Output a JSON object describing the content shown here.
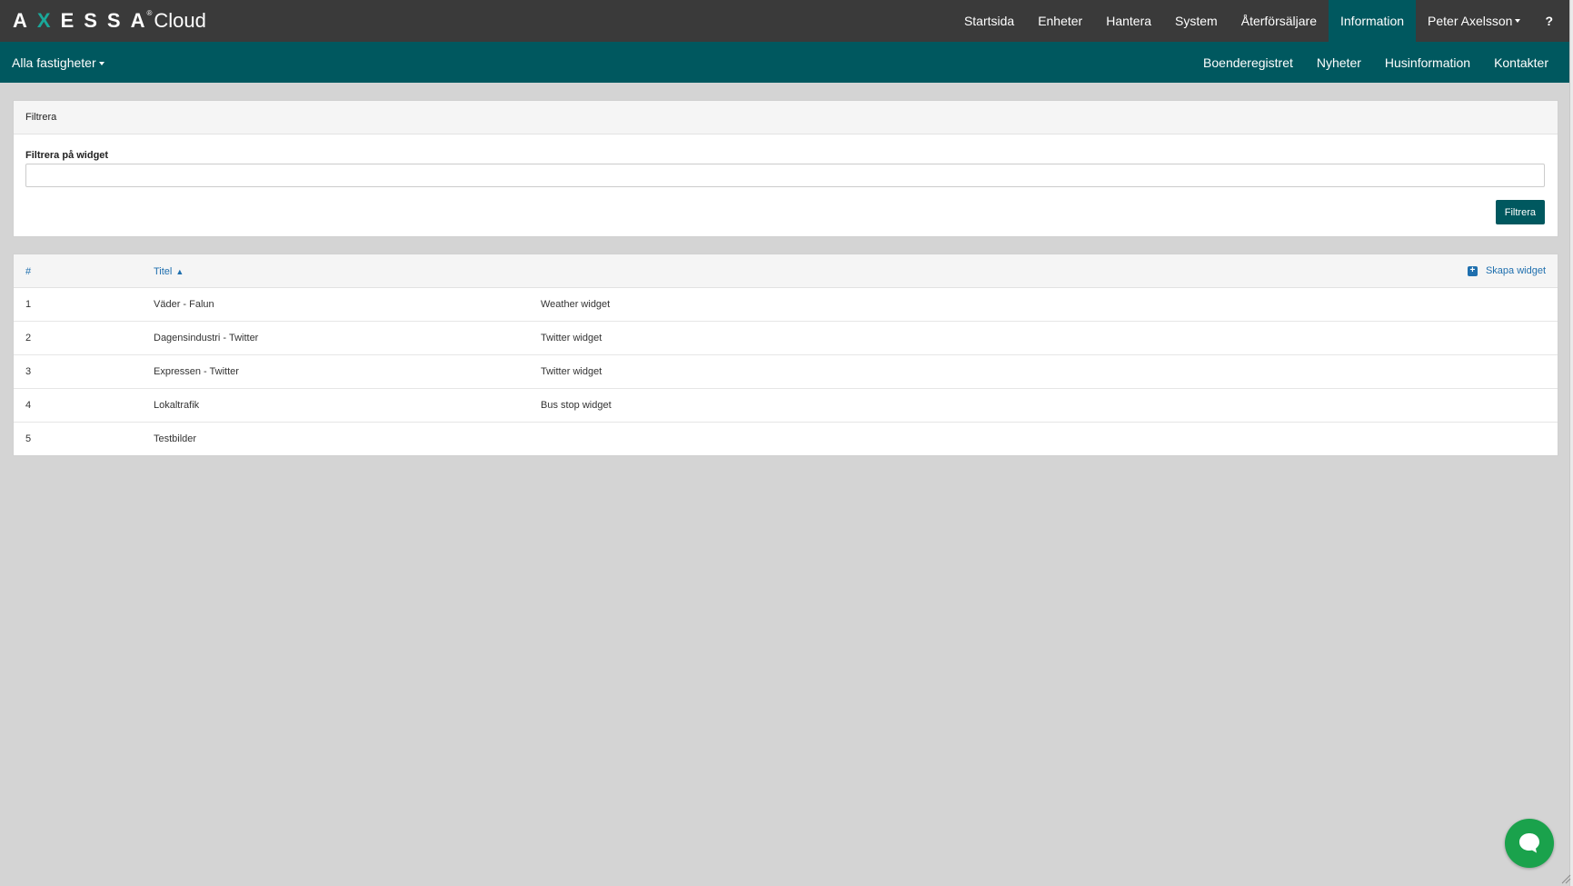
{
  "brand": {
    "letters_1": "A",
    "letters_x": "X",
    "letters_2": "ESSA",
    "reg": "®",
    "cloud": "Cloud"
  },
  "topnav": {
    "items": [
      "Startsida",
      "Enheter",
      "Hantera",
      "System",
      "Återförsäljare",
      "Information",
      "Peter Axelsson",
      "?"
    ],
    "active": "Information"
  },
  "subbar": {
    "property_select": "Alla fastigheter",
    "items": [
      "Boenderegistret",
      "Nyheter",
      "Husinformation",
      "Kontakter"
    ]
  },
  "filter": {
    "heading": "Filtrera",
    "label": "Filtrera på widget",
    "value": "",
    "button": "Filtrera"
  },
  "table": {
    "columns": [
      "#",
      "Titel"
    ],
    "create_label": "Skapa widget",
    "rows": [
      {
        "id": "1",
        "title": "Väder - Falun",
        "type": "Weather widget"
      },
      {
        "id": "2",
        "title": "Dagensindustri - Twitter",
        "type": "Twitter widget"
      },
      {
        "id": "3",
        "title": "Expressen - Twitter",
        "type": "Twitter widget"
      },
      {
        "id": "4",
        "title": "Lokaltrafik",
        "type": "Bus stop widget"
      },
      {
        "id": "5",
        "title": "Testbilder",
        "type": ""
      }
    ]
  },
  "icons": {
    "sort": "sort-icon",
    "plus": "plus-square-icon",
    "chat": "chat-bubble-icon"
  },
  "colors": {
    "topbar": "#3a3a3a",
    "accent": "#00585f",
    "logo_x": "#1aa89a",
    "link": "#1f6fae",
    "chat": "#1aa24c"
  }
}
